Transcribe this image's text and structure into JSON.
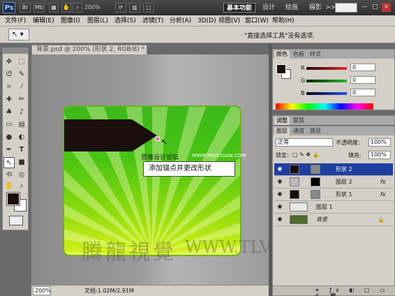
{
  "titlebar": {
    "logo": "Ps",
    "bridge_btn": "Br",
    "mini_btn": "Mb",
    "zoom": "200%",
    "workspaces": [
      "基本功能",
      "设计",
      "绘画",
      "摄影"
    ],
    "overflow": ">>",
    "window_controls": [
      "—",
      "□",
      "×"
    ]
  },
  "menu": [
    "文件(F)",
    "编辑(E)",
    "图像(I)",
    "图层(L)",
    "选择(S)",
    "滤镜(T)",
    "分析(A)",
    "3D(D)",
    "视图(V)",
    "窗口(W)",
    "帮助(H)"
  ],
  "options": {
    "tool_glyph": "↖",
    "hint": "\"直接选择工具\"没有选项."
  },
  "document": {
    "tab_title": "背景.psd @ 200% (形状 2, RGB/8) *",
    "tab_close": "×",
    "callout": "添加锚点并更改形状",
    "watermark_text": "思缘设计论坛",
    "watermark_site": "WWW.MISSYUAN.COM",
    "brand_cn": "腾龍視覺",
    "brand_url": "WWW.TLVI.NET",
    "cursor_glyph": "↖"
  },
  "status": {
    "zoom": "200%",
    "doc_info": "文档:1.02M/2.91M"
  },
  "color_panel": {
    "tabs": [
      "颜色",
      "色板",
      "样式"
    ],
    "r_label": "R",
    "g_label": "G",
    "b_label": "B",
    "r": "0",
    "g": "0",
    "b": "0",
    "colors": {
      "r": "#e03030",
      "g": "#30b030",
      "b": "#3050e0"
    }
  },
  "adjust_panel": {
    "tabs": [
      "调整",
      "蒙版"
    ]
  },
  "layers_panel": {
    "tabs": [
      "图层",
      "通道",
      "路径"
    ],
    "blend_mode": "正常",
    "opacity_label": "不透明度:",
    "opacity": "100%",
    "lock_label": "锁定:",
    "fill_label": "填充:",
    "fill": "100%",
    "layers": [
      {
        "name": "形状 2",
        "fx": ""
      },
      {
        "name": "图层 2",
        "fx": "fx"
      },
      {
        "name": "形状 1",
        "fx": "fx"
      },
      {
        "name": "图层 1",
        "fx": ""
      },
      {
        "name": "背景",
        "fx": ""
      }
    ]
  }
}
